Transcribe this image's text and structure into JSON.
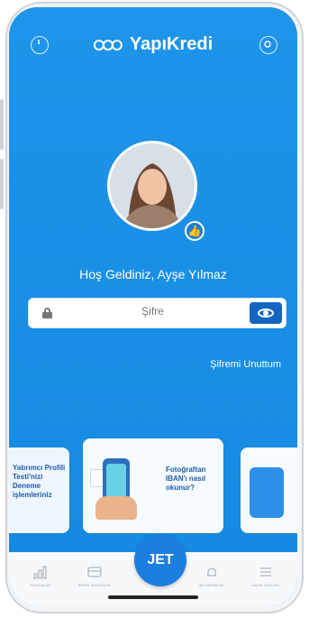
{
  "header": {
    "logo_text": "YapıKredi",
    "left_icon": "power-icon",
    "right_icon": "settings-icon"
  },
  "profile": {
    "welcome_text": "Hoş Geldiniz, Ayşe Yılmaz",
    "badge_icon": "thumbs-up-icon"
  },
  "login": {
    "password_placeholder": "Şifre",
    "forgot_label": "Şifremi Unuttum"
  },
  "cards": {
    "left_text": "Yatırımcı Profili Testi'nizi Deneme işlemleriniz",
    "middle_text": "Fotoğraftan IBAN'ı nasıl okunur?"
  },
  "tabbar": {
    "jet_label": "JET",
    "items": [
      {
        "label": "PİYASALAR",
        "icon": "bar-chart-icon"
      },
      {
        "label": "ŞİFRE İŞLEMLERİ",
        "icon": "card-icon"
      },
      {
        "label": "BİLDİRİMLER",
        "icon": "bell-icon"
      },
      {
        "label": "DAHA FAZLASI",
        "icon": "menu-icon"
      }
    ]
  },
  "colors": {
    "primary_blue": "#1b8fe4",
    "dark_blue": "#1565c0",
    "background": "#f7f8fa"
  }
}
